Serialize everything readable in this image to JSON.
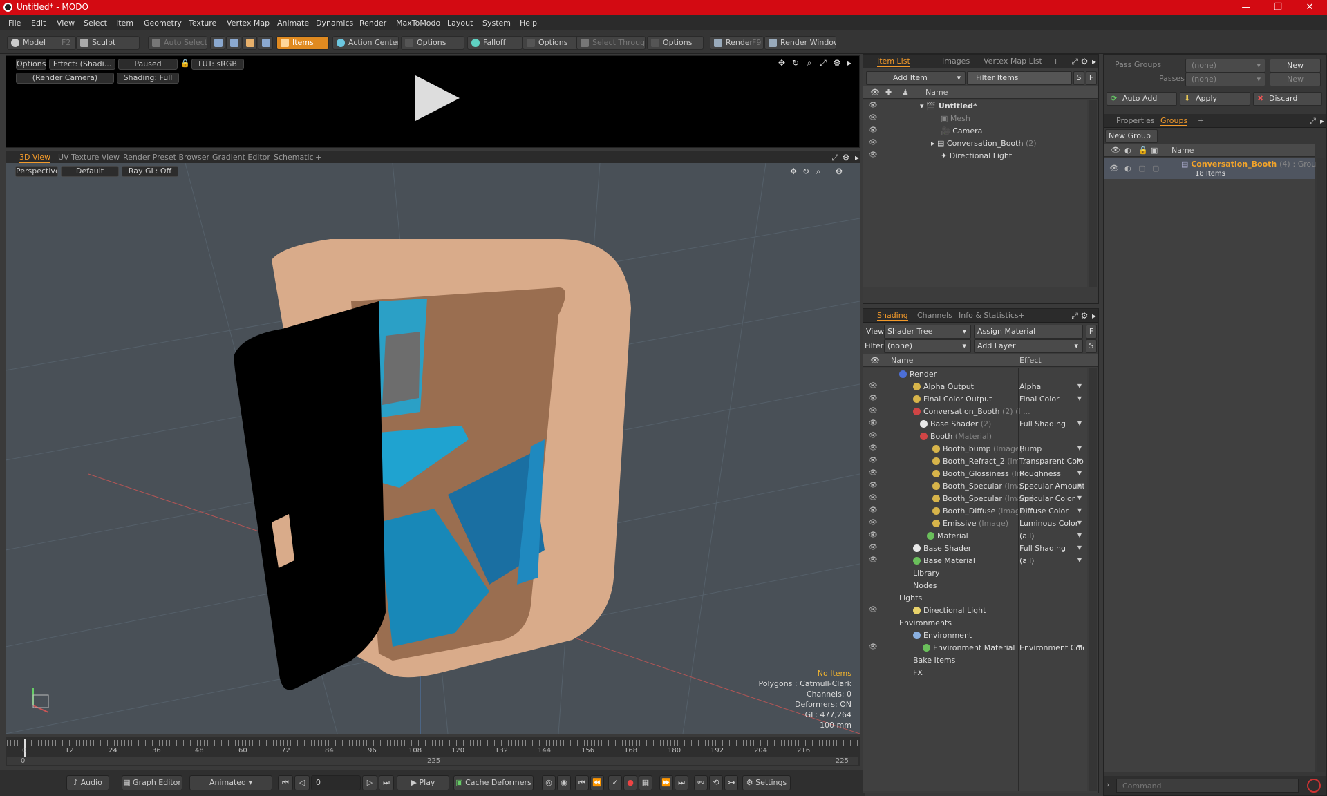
{
  "window": {
    "title": "Untitled* - MODO",
    "min": "—",
    "max": "❐",
    "close": "✕"
  },
  "menu": [
    "File",
    "Edit",
    "View",
    "Select",
    "Item",
    "Geometry",
    "Texture",
    "Vertex Map",
    "Animate",
    "Dynamics",
    "Render",
    "MaxToModo",
    "Layout",
    "System",
    "Help"
  ],
  "toolbar": {
    "model": "Model",
    "model_key": "F2",
    "sculpt": "Sculpt",
    "auto_select": "Auto Select",
    "items": "Items",
    "action_center": "Action Center",
    "options1": "Options",
    "falloff": "Falloff",
    "options2": "Options",
    "select_through": "Select Through",
    "options3": "Options",
    "render": "Render",
    "render_key": "F9",
    "render_window": "Render Window"
  },
  "render_preview": {
    "options": "Options",
    "effect": "Effect: (Shadi...",
    "paused": "Paused",
    "lut": "LUT: sRGB",
    "camera": "(Render Camera)",
    "shading": "Shading: Full"
  },
  "view_tabs": [
    "3D View",
    "UV Texture View",
    "Render Preset Browser",
    "Gradient Editor",
    "Schematic",
    "+"
  ],
  "viewport": {
    "perspective": "Perspective",
    "default": "Default",
    "raygl": "Ray GL: Off",
    "info": {
      "no_items": "No Items",
      "polygons": "Polygons : Catmull-Clark",
      "channels": "Channels: 0",
      "deformers": "Deformers: ON",
      "gl": "GL: 477,264",
      "unit": "100 mm"
    }
  },
  "timeline": {
    "ticks": [
      "0",
      "12",
      "24",
      "36",
      "48",
      "60",
      "72",
      "84",
      "96",
      "108",
      "120",
      "132",
      "144",
      "156",
      "168",
      "180",
      "192",
      "204",
      "216"
    ],
    "start": "0",
    "mid": "225",
    "end": "225"
  },
  "bottom": {
    "audio": "Audio",
    "graph_editor": "Graph Editor",
    "animated": "Animated",
    "frame": "0",
    "play": "Play",
    "cache": "Cache Deformers",
    "settings": "Settings"
  },
  "item_list": {
    "tabs": [
      "Item List",
      "Images",
      "Vertex Map List",
      "+"
    ],
    "add_item": "Add Item",
    "filter": "Filter Items",
    "s": "S",
    "f": "F",
    "col_name": "Name",
    "rows": [
      {
        "name": "Untitled*",
        "extra": ""
      },
      {
        "name": "Mesh",
        "extra": ""
      },
      {
        "name": "Camera",
        "extra": ""
      },
      {
        "name": "Conversation_Booth",
        "extra": "(2)"
      },
      {
        "name": "Directional Light",
        "extra": ""
      }
    ]
  },
  "shading": {
    "tabs": [
      "Shading",
      "Channels",
      "Info & Statistics",
      "+"
    ],
    "view_label": "View",
    "view_value": "Shader Tree",
    "assign": "Assign Material",
    "f": "F",
    "filter_label": "Filter",
    "filter_value": "(none)",
    "add_layer": "Add Layer",
    "s": "S",
    "col_name": "Name",
    "col_effect": "Effect",
    "rows": [
      {
        "name": "Render",
        "extra": "",
        "effect": ""
      },
      {
        "name": "Alpha Output",
        "extra": "",
        "effect": "Alpha"
      },
      {
        "name": "Final Color Output",
        "extra": "",
        "effect": "Final Color"
      },
      {
        "name": "Conversation_Booth",
        "extra": "(2) (I ...",
        "effect": ""
      },
      {
        "name": "Base Shader",
        "extra": "(2)",
        "effect": "Full Shading"
      },
      {
        "name": "Booth",
        "extra": "(Material)",
        "effect": ""
      },
      {
        "name": "Booth_bump",
        "extra": "(Image)",
        "effect": "Bump"
      },
      {
        "name": "Booth_Refract_2",
        "extra": "(Im ...",
        "effect": "Transparent Color"
      },
      {
        "name": "Booth_Glossiness",
        "extra": "(Im ...",
        "effect": "Roughness"
      },
      {
        "name": "Booth_Specular",
        "extra": "(Ima ...",
        "effect": "Specular Amount"
      },
      {
        "name": "Booth_Specular",
        "extra": "(Image)",
        "effect": "Specular Color"
      },
      {
        "name": "Booth_Diffuse",
        "extra": "(Image)",
        "effect": "Diffuse Color"
      },
      {
        "name": "Emissive",
        "extra": "(Image)",
        "effect": "Luminous Color"
      },
      {
        "name": "Material",
        "extra": "",
        "effect": "(all)"
      },
      {
        "name": "Base Shader",
        "extra": "",
        "effect": "Full Shading"
      },
      {
        "name": "Base Material",
        "extra": "",
        "effect": "(all)"
      },
      {
        "name": "Library",
        "extra": "",
        "effect": ""
      },
      {
        "name": "Nodes",
        "extra": "",
        "effect": ""
      },
      {
        "name": "Lights",
        "extra": "",
        "effect": ""
      },
      {
        "name": "Directional Light",
        "extra": "",
        "effect": ""
      },
      {
        "name": "Environments",
        "extra": "",
        "effect": ""
      },
      {
        "name": "Environment",
        "extra": "",
        "effect": ""
      },
      {
        "name": "Environment Material",
        "extra": "",
        "effect": "Environment Color"
      },
      {
        "name": "Bake Items",
        "extra": "",
        "effect": ""
      },
      {
        "name": "FX",
        "extra": "",
        "effect": ""
      }
    ]
  },
  "right": {
    "pass_groups_label": "Pass Groups",
    "pass_groups_value": "(none)",
    "new1": "New",
    "passes_label": "Passes",
    "passes_value": "(none)",
    "new2": "New",
    "auto_add": "Auto Add",
    "apply": "Apply",
    "discard": "Discard",
    "tabs": [
      "Properties",
      "Groups",
      "+"
    ],
    "new_group": "New Group",
    "col_name": "Name",
    "group_name": "Conversation_Booth",
    "group_count": "(4)",
    "group_type": ": Group",
    "group_items": "18 Items",
    "command_placeholder": "Command"
  }
}
